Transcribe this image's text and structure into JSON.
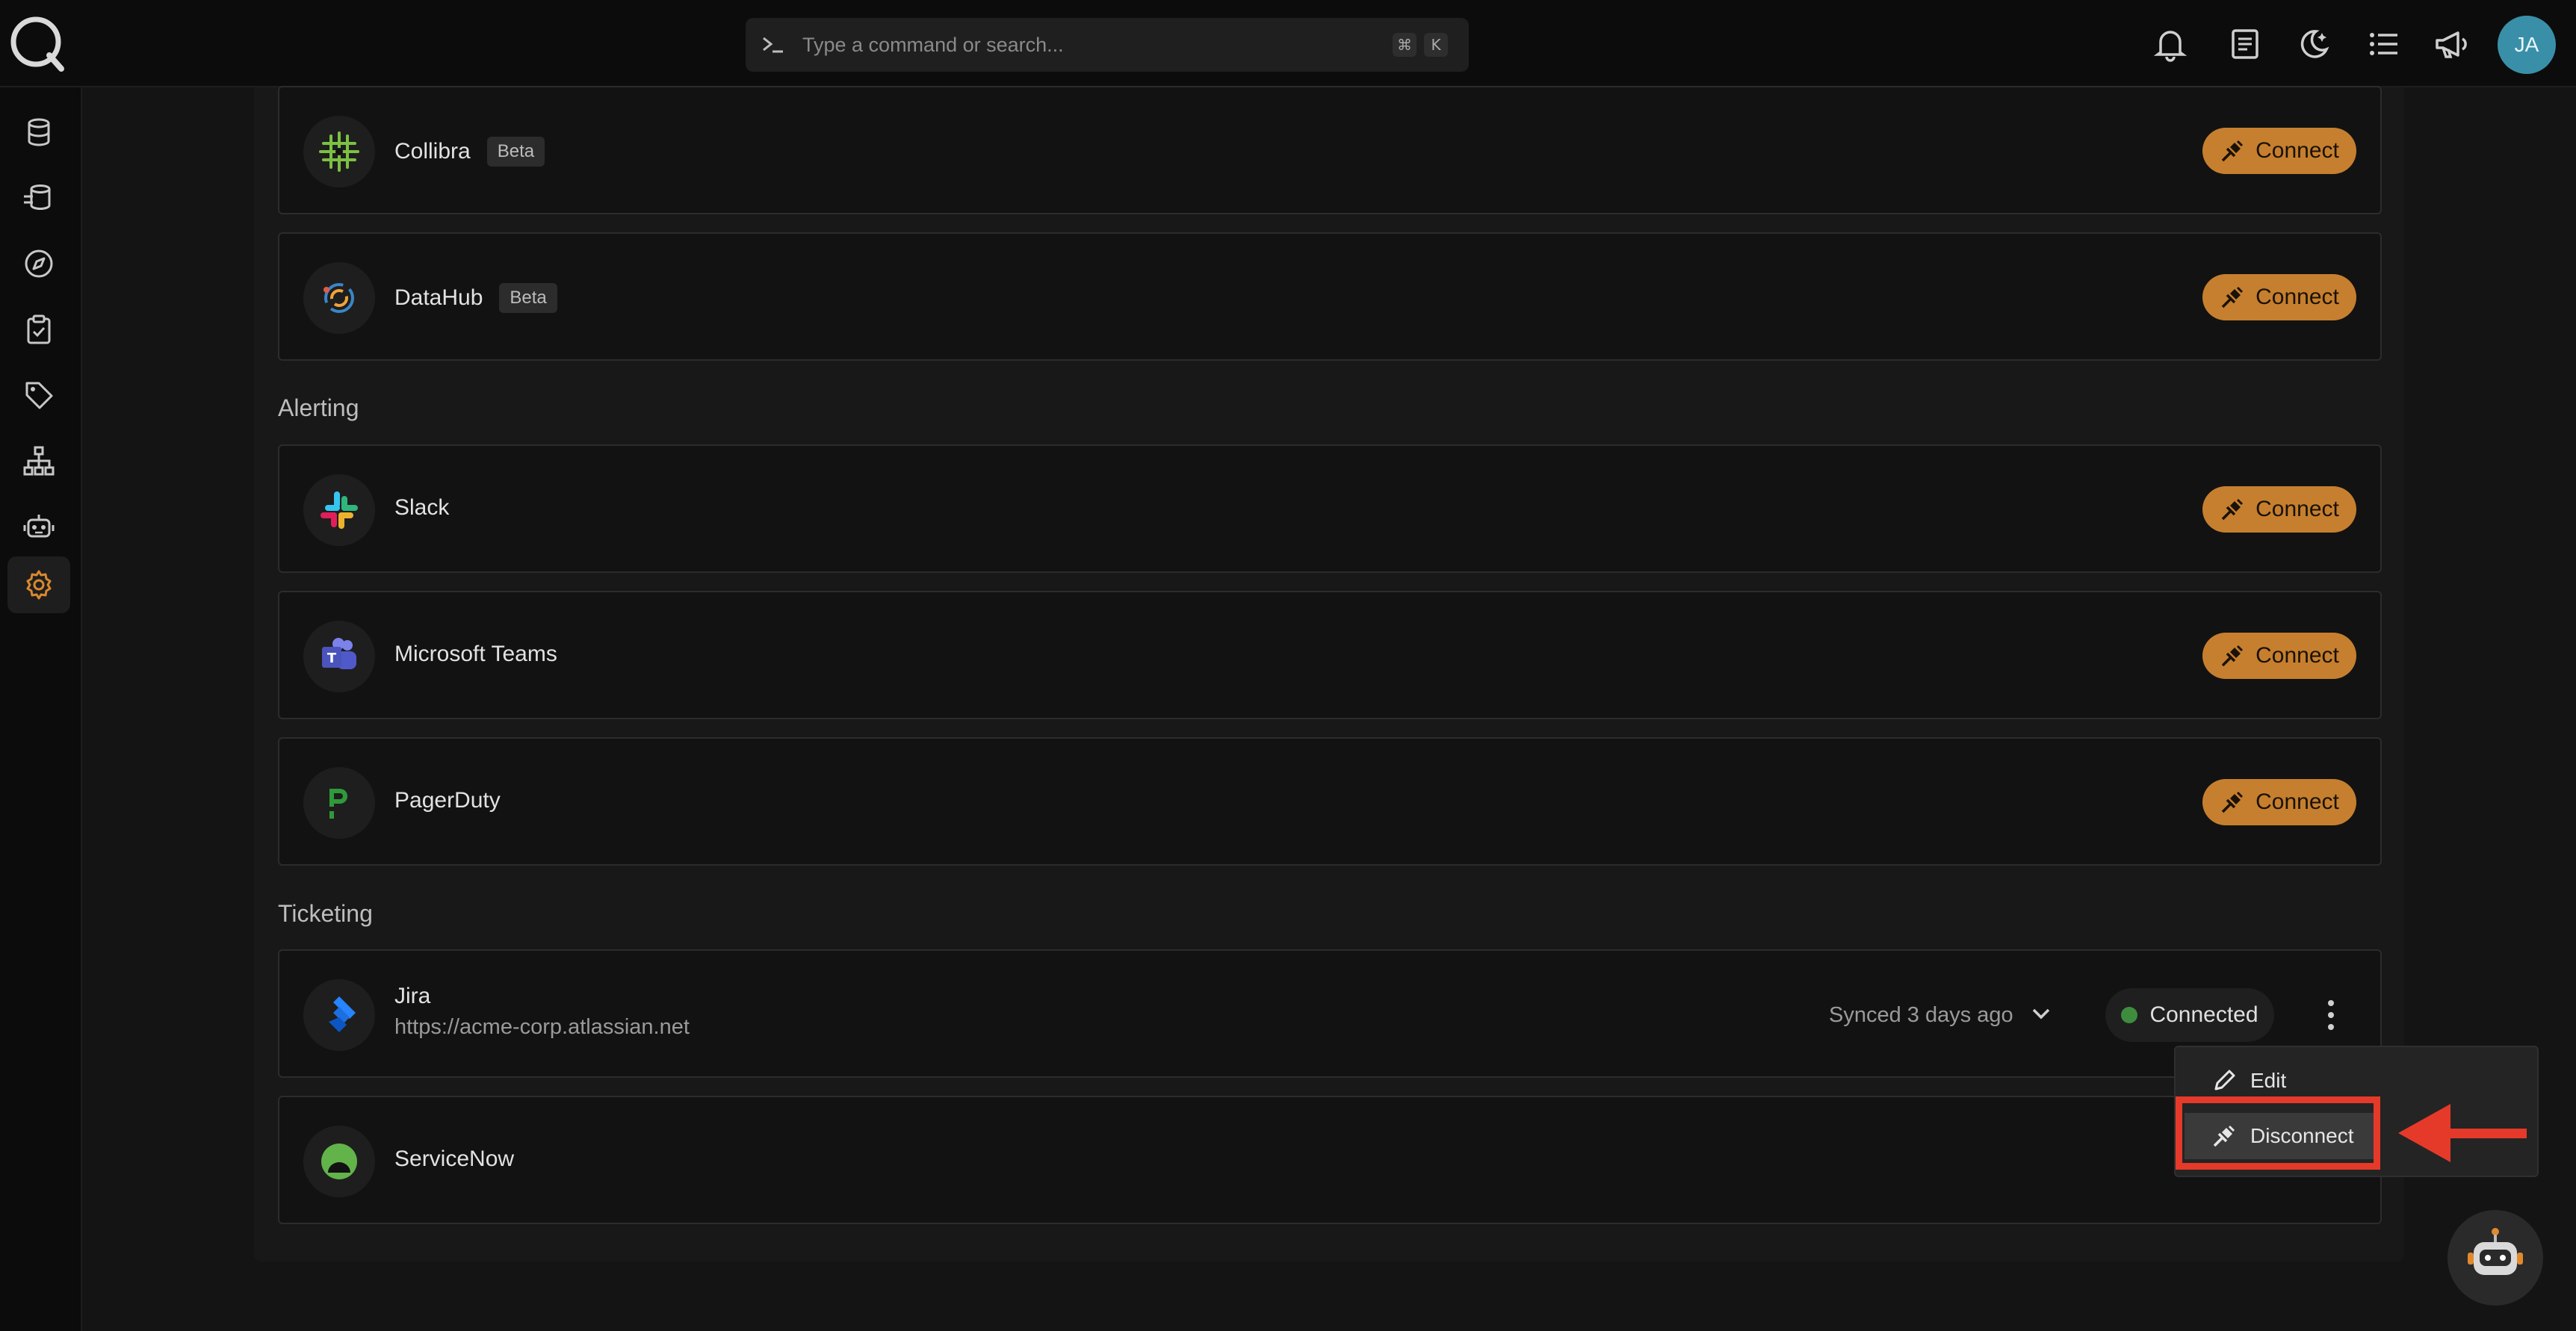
{
  "search": {
    "placeholder": "Type a command or search...",
    "kbd_cmd": "⌘",
    "kbd_key": "K"
  },
  "user": {
    "initials": "JA"
  },
  "colors": {
    "accent": "#c67f2f",
    "connected_dot": "#3e8d3e",
    "highlight": "#e53a2a",
    "avatar": "#3a8fa8"
  },
  "sections": {
    "alerting": "Alerting",
    "ticketing": "Ticketing"
  },
  "integrations": {
    "collibra": {
      "name": "Collibra",
      "badge": "Beta",
      "action": "Connect"
    },
    "datahub": {
      "name": "DataHub",
      "badge": "Beta",
      "action": "Connect"
    },
    "slack": {
      "name": "Slack",
      "action": "Connect"
    },
    "teams": {
      "name": "Microsoft Teams",
      "action": "Connect"
    },
    "pagerduty": {
      "name": "PagerDuty",
      "action": "Connect"
    },
    "jira": {
      "name": "Jira",
      "url": "https://acme-corp.atlassian.net",
      "synced": "Synced 3 days ago",
      "status": "Connected"
    },
    "servicenow": {
      "name": "ServiceNow"
    }
  },
  "menu": {
    "edit": "Edit",
    "disconnect": "Disconnect"
  }
}
